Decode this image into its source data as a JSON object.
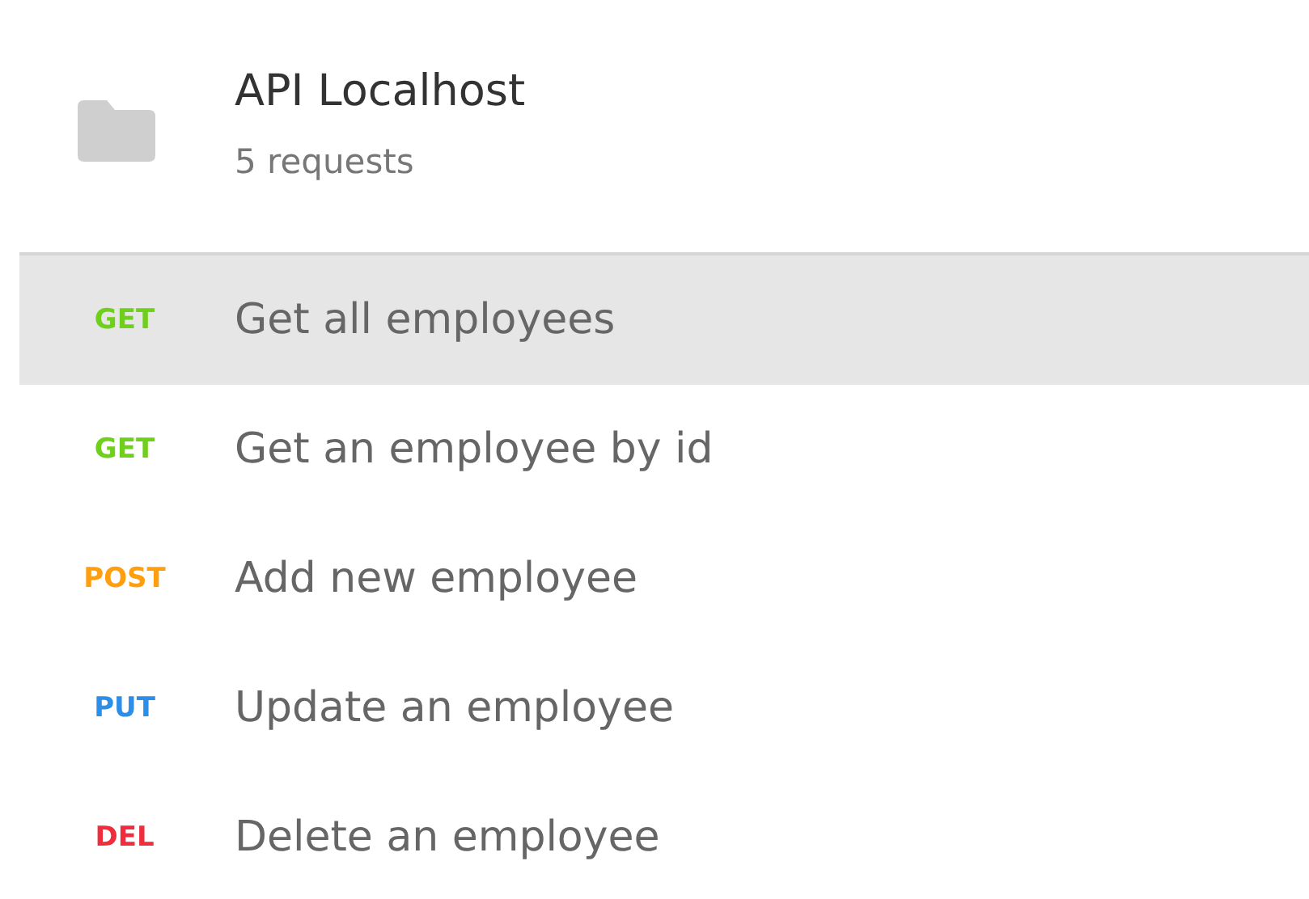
{
  "collection": {
    "title": "API Localhost",
    "subtitle": "5 requests"
  },
  "requests": [
    {
      "method": "GET",
      "color": "#6fd01b",
      "name": "Get all employees",
      "selected": true
    },
    {
      "method": "GET",
      "color": "#6fd01b",
      "name": "Get an employee by id",
      "selected": false
    },
    {
      "method": "POST",
      "color": "#ff9f0f",
      "name": "Add new employee",
      "selected": false
    },
    {
      "method": "PUT",
      "color": "#2d8ee8",
      "name": "Update an employee",
      "selected": false
    },
    {
      "method": "DEL",
      "color": "#ef2d3c",
      "name": "Delete an employee",
      "selected": false
    }
  ]
}
